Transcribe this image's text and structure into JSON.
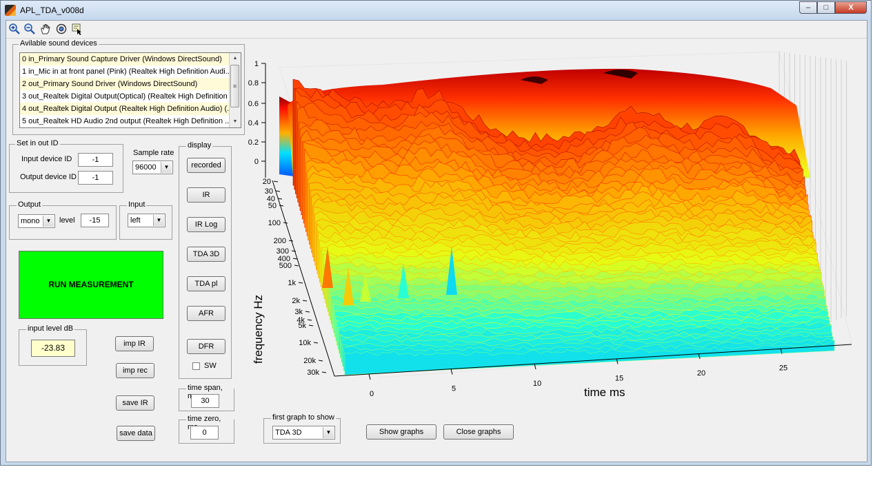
{
  "window": {
    "title": "APL_TDA_v008d",
    "min_glyph": "‒",
    "max_glyph": "□",
    "close_glyph": "X"
  },
  "toolbar": {
    "icons": [
      "zoom-in-icon",
      "zoom-out-icon",
      "pan-hand-icon",
      "rotate-3d-icon",
      "data-cursor-icon"
    ]
  },
  "devices": {
    "legend": "Avilable sound devices",
    "items": [
      "0 in_Primary Sound Capture Driver (Windows DirectSound)",
      "1 in_Mic in at front panel (Pink) (Realtek High Definition Audi...",
      "2 out_Primary Sound Driver (Windows DirectSound)",
      "3 out_Realtek Digital Output(Optical) (Realtek High Definition ...",
      "4 out_Realtek Digital Output (Realtek High Definition Audio) (...",
      "5 out_Realtek HD Audio 2nd output (Realtek High Definition ..."
    ]
  },
  "setio": {
    "legend": "Set in out ID",
    "input_label": "Input device ID",
    "input_value": "-1",
    "output_label": "Output device ID",
    "output_value": "-1"
  },
  "sample_rate": {
    "label": "Sample rate",
    "value": "96000"
  },
  "output": {
    "legend": "Output",
    "mode": "mono",
    "level_label": "level",
    "level_value": "-15"
  },
  "input": {
    "legend": "Input",
    "channel": "left"
  },
  "run_button": "RUN MEASUREMENT",
  "input_level": {
    "legend": "input level dB",
    "value": "-23.83"
  },
  "actions": {
    "imp_ir": "imp IR",
    "imp_rec": "imp rec",
    "save_ir": "save IR",
    "save_data": "save data"
  },
  "display": {
    "legend": "display",
    "buttons": [
      "recorded",
      "IR",
      "IR Log",
      "TDA 3D",
      "TDA pl",
      "AFR",
      "DFR"
    ],
    "sw_label": "SW"
  },
  "time_span": {
    "legend": "time span, ms",
    "value": "30"
  },
  "time_zero": {
    "legend": "time zero, ms",
    "value": "0"
  },
  "first_graph": {
    "legend": "first graph to show",
    "value": "TDA 3D"
  },
  "show_graphs": "Show graphs",
  "close_graphs": "Close graphs",
  "plot": {
    "z_ticks": [
      "0",
      "0.2",
      "0.4",
      "0.6",
      "0.8",
      "1"
    ],
    "freq_ticks": [
      "20",
      "30",
      "40",
      "50",
      "100",
      "200",
      "300",
      "400",
      "500",
      "1k",
      "2k",
      "3k",
      "4k",
      "5k",
      "10k",
      "20k",
      "30k"
    ],
    "freq_label": "frequency   Hz",
    "time_ticks": [
      "0",
      "5",
      "10",
      "15",
      "20",
      "25"
    ],
    "time_label": "time   ms",
    "colors": {
      "low": "#0000ff",
      "mid": "#00ffff",
      "high": "#ffff00",
      "peak": "#ff0000",
      "top": "#800000"
    }
  }
}
